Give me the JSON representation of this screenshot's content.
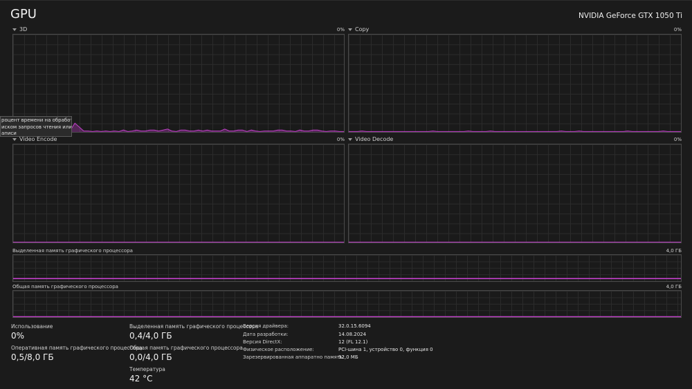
{
  "header": {
    "title": "GPU",
    "gpu_name": "NVIDIA GeForce GTX 1050 Ti"
  },
  "engines": [
    {
      "label": "3D",
      "percent": "0%"
    },
    {
      "label": "Copy",
      "percent": "0%"
    },
    {
      "label": "Video Encode",
      "percent": "0%"
    },
    {
      "label": "Video Decode",
      "percent": "0%"
    }
  ],
  "dedicated_memory": {
    "label": "Выделенная память графического процессора",
    "max": "4,0 ГБ"
  },
  "shared_memory": {
    "label": "Общая память графического процессора",
    "max": "4,0 ГБ"
  },
  "tooltip": {
    "line1": "роцент времени на обработку",
    "line2": "иском запросов чтения или",
    "line3": "аписи"
  },
  "stats": {
    "usage_label": "Использование",
    "usage_value": "0%",
    "gpu_mem_label": "Оперативная память графического процессора",
    "gpu_mem_value": "0,5/8,0 ГБ",
    "dedicated_label": "Выделенная память графического процессора",
    "dedicated_value": "0,4/4,0 ГБ",
    "shared_label": "Общая память графического процессора",
    "shared_value": "0,0/4,0 ГБ",
    "temp_label": "Температура",
    "temp_value": "42 °C"
  },
  "properties": [
    {
      "key": "Версия драйвера:",
      "value": "32.0.15.6094"
    },
    {
      "key": "Дата разработки:",
      "value": "14.08.2024"
    },
    {
      "key": "Версия DirectX:",
      "value": "12 (FL 12.1)"
    },
    {
      "key": "Физическое расположение:",
      "value": "PCI-шина 1, устройство 0, функция 0"
    },
    {
      "key": "Зарезервированная аппаратно память:",
      "value": "92,0 МБ"
    }
  ],
  "colors": {
    "accent": "#c040c8",
    "grid": "#2b2b2b",
    "border": "#4a4a4a"
  },
  "chart_data": [
    {
      "type": "area",
      "title": "3D",
      "ylim": [
        0,
        100
      ],
      "series": [
        {
          "values": [
            0,
            0,
            0,
            1,
            1,
            0,
            1,
            2,
            2,
            3,
            4,
            8,
            3,
            2,
            9,
            5,
            1,
            1,
            0,
            1,
            0,
            1,
            0,
            1,
            0,
            2,
            0,
            1,
            2,
            1,
            1,
            2,
            2,
            1,
            2,
            3,
            1,
            0,
            2,
            2,
            1,
            1,
            2,
            1,
            2,
            1,
            1,
            1,
            3,
            1,
            1,
            2,
            2,
            0,
            2,
            1,
            0,
            1,
            1,
            1,
            2,
            2,
            1,
            1,
            0,
            2,
            1,
            1,
            2,
            2,
            1,
            0,
            1,
            1,
            0,
            0
          ]
        }
      ]
    },
    {
      "type": "area",
      "title": "Copy",
      "ylim": [
        0,
        100
      ],
      "series": [
        {
          "values": [
            0,
            0,
            0,
            1,
            0,
            0,
            0,
            0,
            0,
            0,
            0,
            0,
            0,
            0,
            0,
            0,
            0,
            0,
            0,
            1,
            0,
            0,
            0,
            0,
            0,
            0,
            0,
            1,
            0,
            0,
            0,
            0,
            1,
            0,
            0,
            0,
            0,
            0,
            0,
            0,
            0,
            0,
            0,
            0,
            0,
            0,
            0,
            0,
            1,
            0,
            0,
            0,
            1,
            0,
            0,
            0,
            0,
            0,
            0,
            0,
            0,
            0,
            0,
            1,
            0,
            0,
            0,
            0,
            0,
            0,
            0,
            1,
            0,
            0,
            0,
            0
          ]
        }
      ]
    },
    {
      "type": "area",
      "title": "Video Encode",
      "ylim": [
        0,
        100
      ],
      "series": [
        {
          "values": [
            0,
            0
          ]
        }
      ]
    },
    {
      "type": "area",
      "title": "Video Decode",
      "ylim": [
        0,
        100
      ],
      "series": [
        {
          "values": [
            0,
            0
          ]
        }
      ]
    },
    {
      "type": "line",
      "title": "Выделенная память графического процессора",
      "ylim": [
        0,
        4.0
      ],
      "series": [
        {
          "values": [
            0.4,
            0.4,
            0.4,
            0.4,
            0.4,
            0.4,
            0.4,
            0.4,
            0.4,
            0.4,
            0.4,
            0.4,
            0.4,
            0.4,
            0.4,
            0.4,
            0.4,
            0.4,
            0.4,
            0.4,
            0.4,
            0.4,
            0.4,
            0.4,
            0.4,
            0.4,
            0.4,
            0.4,
            0.4,
            0.4,
            0.4,
            0.4,
            0.4,
            0.4,
            0.4,
            0.4,
            0.4,
            0.4,
            0.4,
            0.4
          ]
        }
      ]
    },
    {
      "type": "line",
      "title": "Общая память графического процессора",
      "ylim": [
        0,
        4.0
      ],
      "series": [
        {
          "values": [
            0.0,
            0.0
          ]
        }
      ]
    }
  ]
}
